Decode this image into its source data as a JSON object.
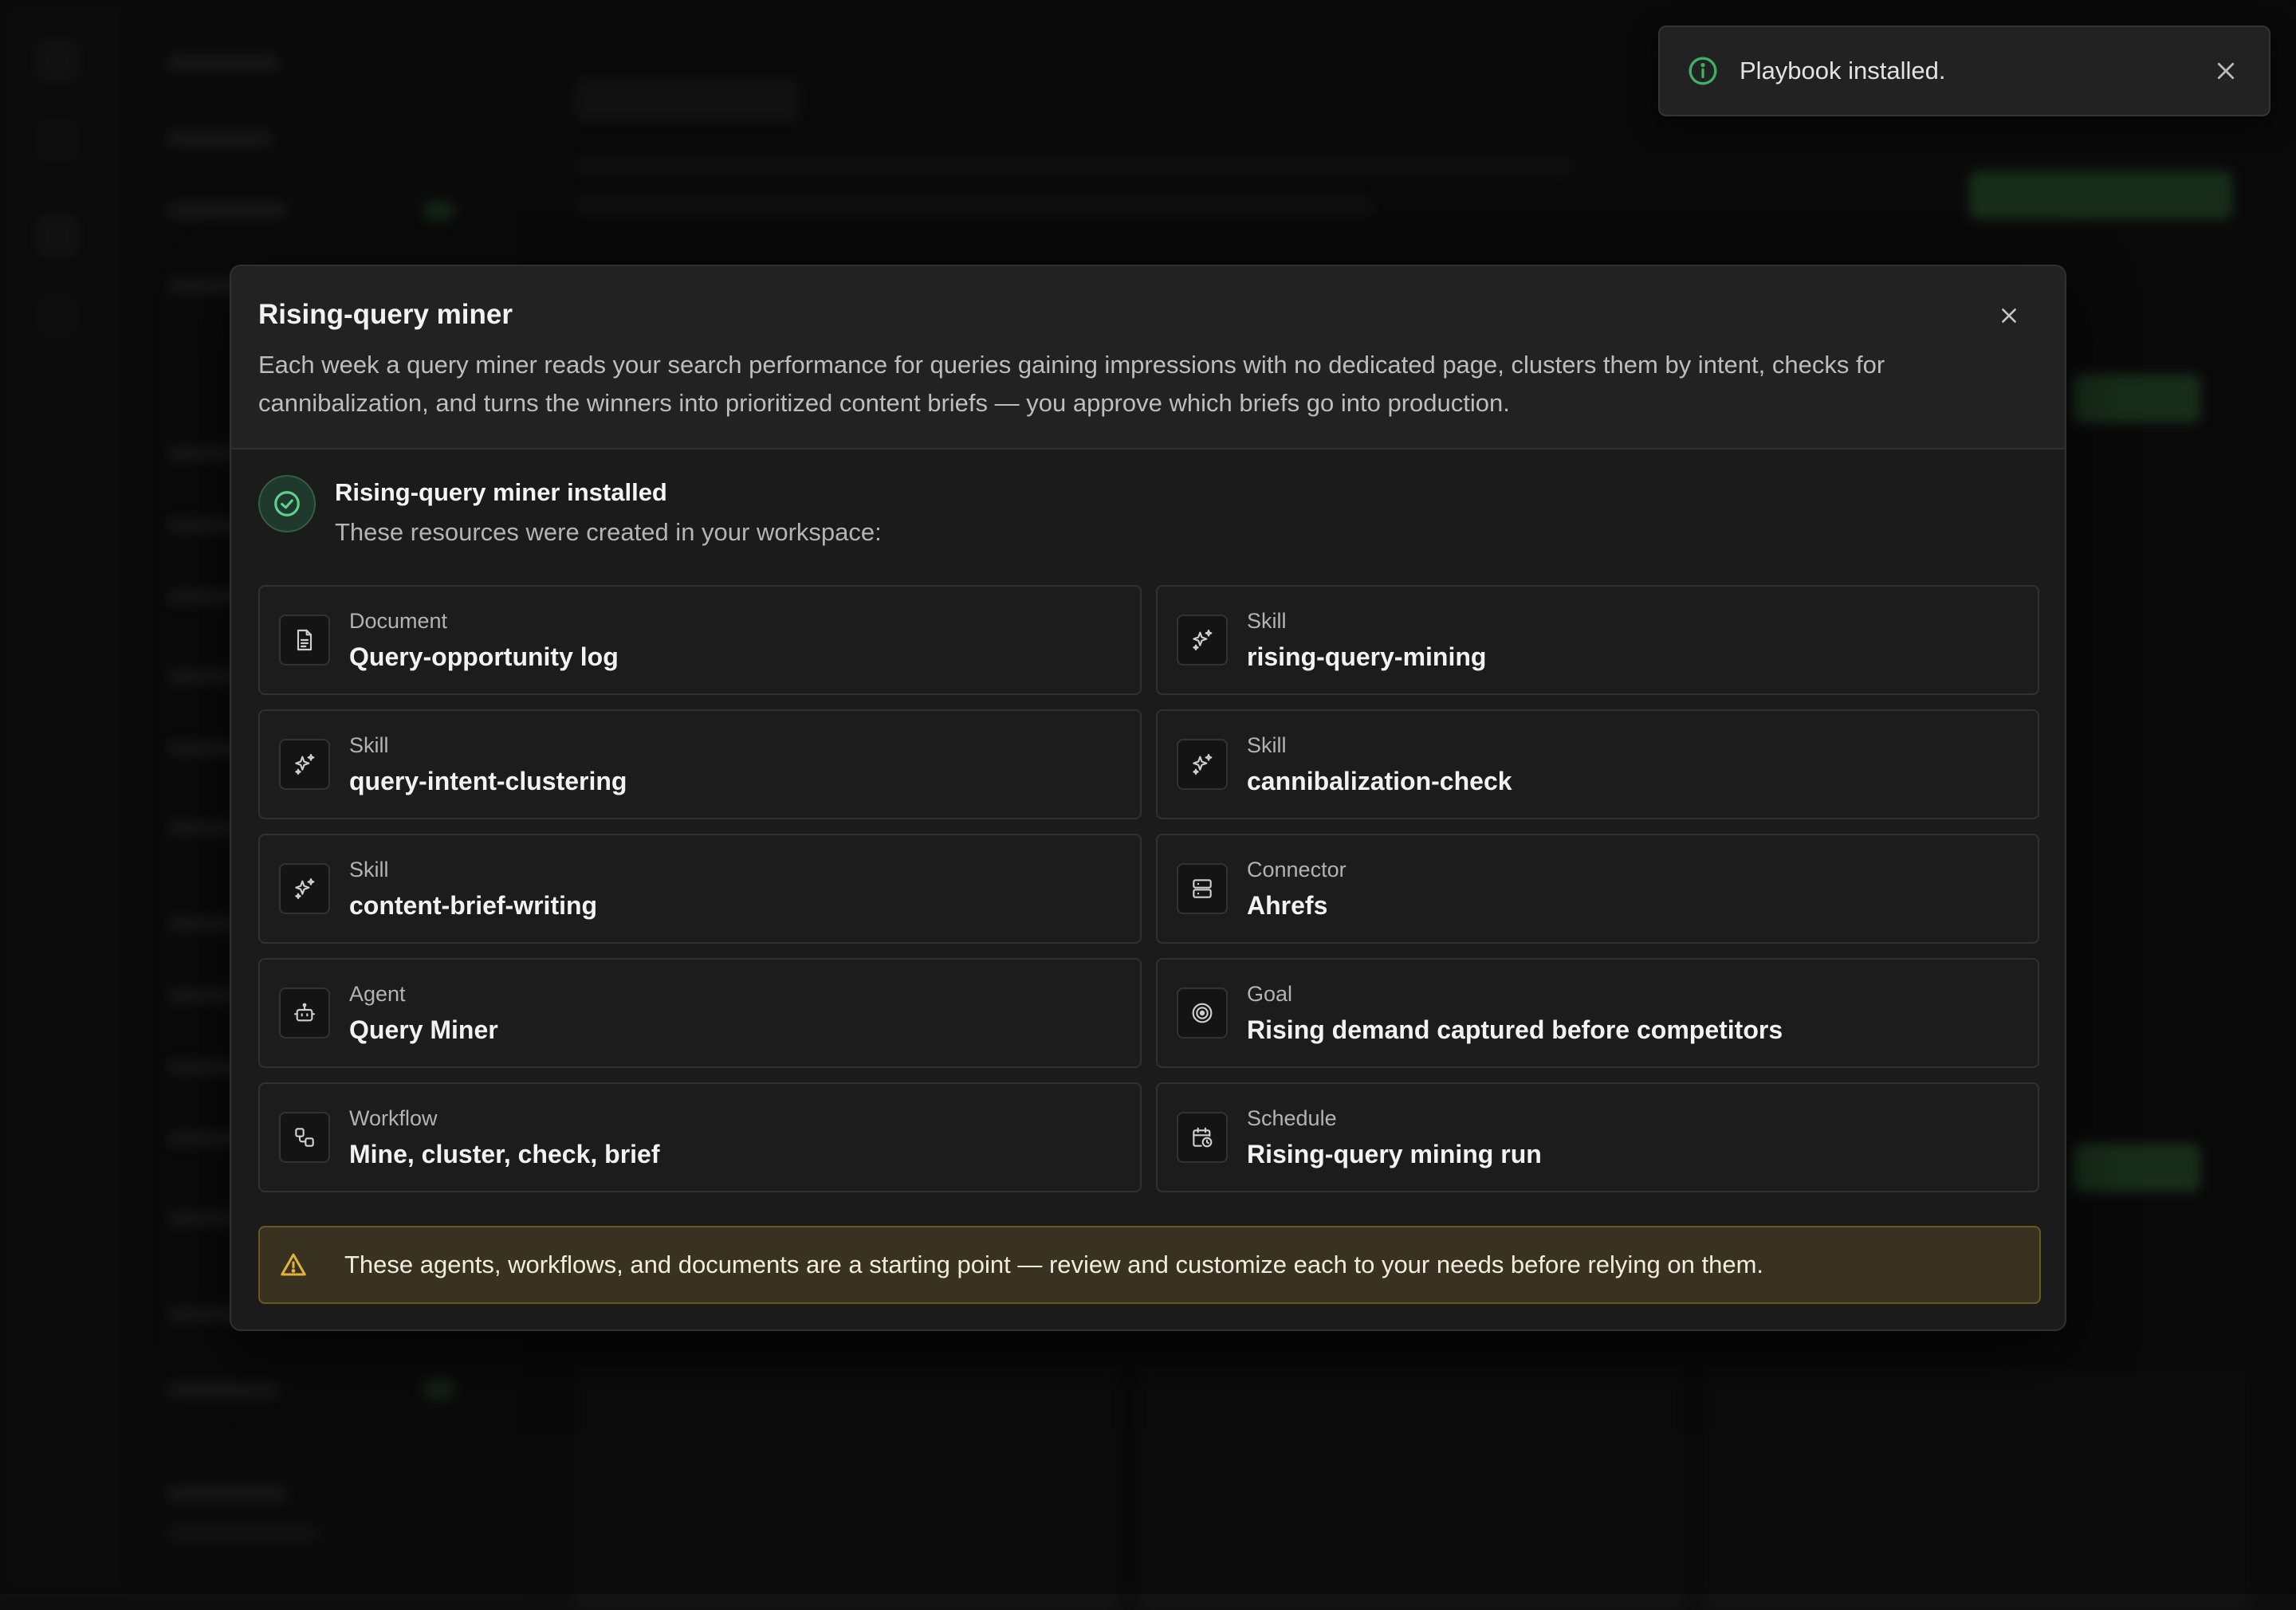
{
  "toast": {
    "message": "Playbook installed.",
    "icon": "info-icon",
    "accent": "#3fb068"
  },
  "modal": {
    "title": "Rising-query miner",
    "description": "Each week a query miner reads your search performance for queries gaining impressions with no dedicated page, clusters them by intent, checks for cannibalization, and turns the winners into prioritized content briefs — you approve which briefs go into production.",
    "installed": {
      "title": "Rising-query miner installed",
      "subtitle": "These resources were created in your workspace:"
    },
    "resources": [
      {
        "type": "Document",
        "name": "Query-opportunity log",
        "icon": "document-icon"
      },
      {
        "type": "Skill",
        "name": "rising-query-mining",
        "icon": "sparkle-icon"
      },
      {
        "type": "Skill",
        "name": "query-intent-clustering",
        "icon": "sparkle-icon"
      },
      {
        "type": "Skill",
        "name": "cannibalization-check",
        "icon": "sparkle-icon"
      },
      {
        "type": "Skill",
        "name": "content-brief-writing",
        "icon": "sparkle-icon"
      },
      {
        "type": "Connector",
        "name": "Ahrefs",
        "icon": "server-icon"
      },
      {
        "type": "Agent",
        "name": "Query Miner",
        "icon": "robot-icon"
      },
      {
        "type": "Goal",
        "name": "Rising demand captured before competitors",
        "icon": "target-icon"
      },
      {
        "type": "Workflow",
        "name": "Mine, cluster, check, brief",
        "icon": "workflow-icon"
      },
      {
        "type": "Schedule",
        "name": "Rising-query mining run",
        "icon": "calendar-clock-icon"
      }
    ],
    "warning": "These agents, workflows, and documents are a starting point — review and customize each to your needs before relying on them."
  },
  "colors": {
    "success": "#3fb068",
    "warning_bg": "#3a3220",
    "warning_border": "#6a5822",
    "warning_icon": "#e0b43a"
  }
}
